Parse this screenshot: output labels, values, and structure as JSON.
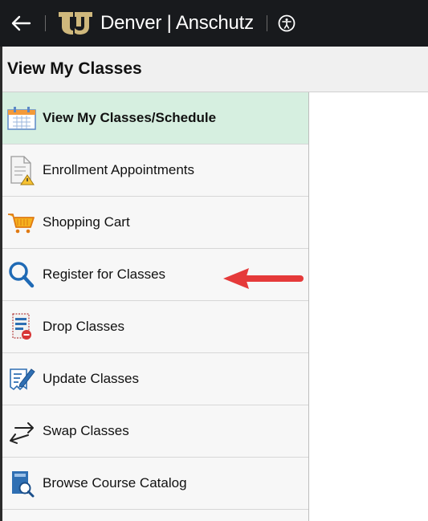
{
  "banner": {
    "brand": "Denver | Anschutz",
    "icons": [
      "back-arrow-icon",
      "cu-logo-icon",
      "accessibility-icon"
    ]
  },
  "page": {
    "title": "View My Classes"
  },
  "nav": {
    "items": [
      {
        "label": "View My Classes/Schedule",
        "icon": "calendar-icon",
        "active": true
      },
      {
        "label": "Enrollment Appointments",
        "icon": "document-warning-icon",
        "active": false
      },
      {
        "label": "Shopping Cart",
        "icon": "shopping-cart-icon",
        "active": false
      },
      {
        "label": "Register for Classes",
        "icon": "search-icon",
        "active": false
      },
      {
        "label": "Drop Classes",
        "icon": "drop-list-icon",
        "active": false
      },
      {
        "label": "Update Classes",
        "icon": "edit-document-icon",
        "active": false
      },
      {
        "label": "Swap Classes",
        "icon": "swap-arrows-icon",
        "active": false
      },
      {
        "label": "Browse Course Catalog",
        "icon": "catalog-search-icon",
        "active": false
      }
    ]
  },
  "colors": {
    "banner": "#181a1d",
    "active_item": "#d6efe0",
    "annotation_arrow": "#e53a3a",
    "logo_gold": "#cfb87c"
  }
}
